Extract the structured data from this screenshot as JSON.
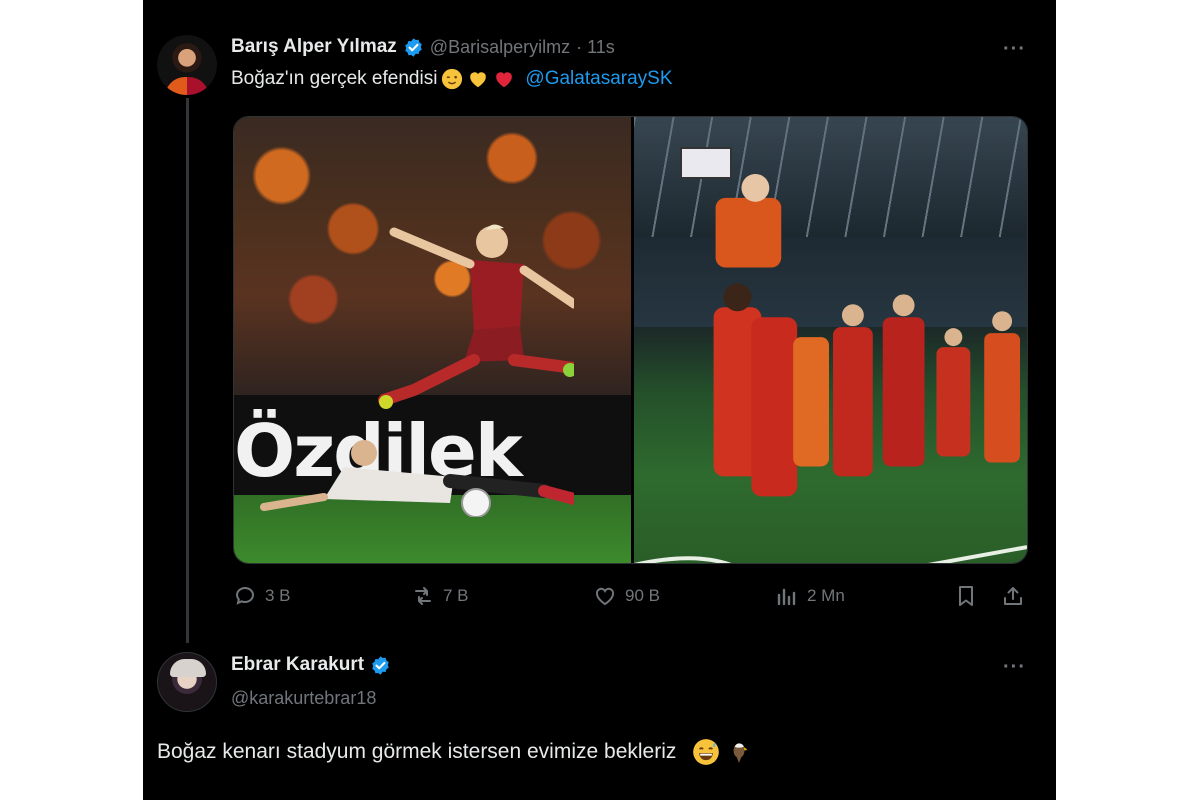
{
  "tweet": {
    "author_name": "Barış Alper Yılmaz",
    "author_handle": "@Barisalperyilmz",
    "time": "· 11s",
    "more_label": "···",
    "text": "Boğaz'ın gerçek efendisi",
    "emojis": [
      "winking-face-emoji",
      "yellow-heart-emoji",
      "red-heart-emoji"
    ],
    "mention": "@GalatasaraySK",
    "media": {
      "photo1_board_text": "Özdilek"
    },
    "actions": {
      "replies": "3 B",
      "reposts": "7 B",
      "likes": "90 B",
      "views": "2 Mn"
    }
  },
  "reply": {
    "author_name": "Ebrar Karakurt",
    "author_handle": "@karakurtebrar18",
    "more_label": "···",
    "text": "Boğaz kenarı  stadyum görmek istersen evimize bekleriz",
    "emojis": [
      "grinning-sweat-emoji",
      "eagle-emoji"
    ]
  },
  "colors": {
    "background": "#000000",
    "text_primary": "#e7e9ea",
    "text_secondary": "#71767b",
    "accent": "#1d9bf0"
  }
}
